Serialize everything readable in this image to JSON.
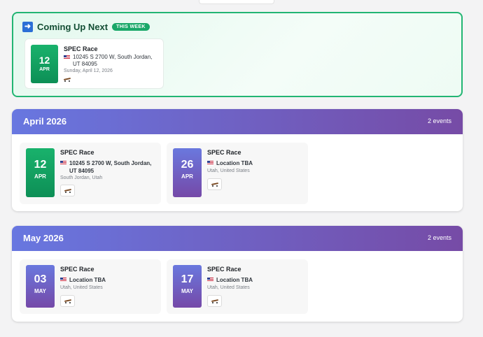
{
  "coming_up": {
    "icon": "right-arrow-icon",
    "title": "Coming Up Next",
    "badge": "THIS WEEK",
    "event": {
      "day": "12",
      "month": "APR",
      "title": "SPEC Race",
      "address": "10245 S 2700 W, South Jordan, UT 84095",
      "date_text": "Sunday, April 12, 2026",
      "icon": "skateboard-icon"
    }
  },
  "months": [
    {
      "title": "April 2026",
      "count": "2 events",
      "events": [
        {
          "day": "12",
          "month": "APR",
          "title": "SPEC Race",
          "address": "10245 S 2700 W, South Jordan, UT 84095",
          "location": "South Jordan, Utah",
          "color": "#19b26c"
        },
        {
          "day": "26",
          "month": "APR",
          "title": "SPEC Race",
          "address": "Location TBA",
          "location": "Utah, United States",
          "color": "#6a78de"
        }
      ]
    },
    {
      "title": "May 2026",
      "count": "2 events",
      "events": [
        {
          "day": "03",
          "month": "MAY",
          "title": "SPEC Race",
          "address": "Location TBA",
          "location": "Utah, United States",
          "color": "#6a78de"
        },
        {
          "day": "17",
          "month": "MAY",
          "title": "SPEC Race",
          "address": "Location TBA",
          "location": "Utah, United States",
          "color": "#6a78de"
        }
      ]
    }
  ],
  "colors": {
    "accent_green": "#22b573",
    "header_gradient_start": "#6877e0",
    "header_gradient_end": "#764ba6"
  }
}
